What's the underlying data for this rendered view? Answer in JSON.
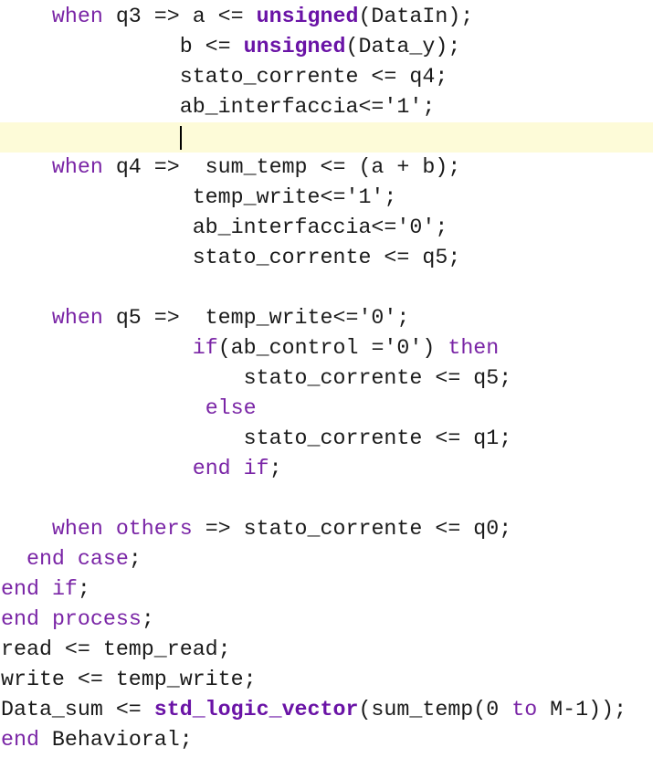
{
  "editor": {
    "language": "VHDL",
    "current_line_index": 4,
    "colors": {
      "keyword": "#7a25a6",
      "builtin_function": "#6a13a6",
      "text": "#1a1a1a",
      "current_line_highlight": "#fdfbd8"
    },
    "lines": [
      [
        {
          "t": "    "
        },
        {
          "t": "when",
          "k": "kw"
        },
        {
          "t": " q3 => a <= "
        },
        {
          "t": "unsigned",
          "k": "fn"
        },
        {
          "t": "(DataIn);"
        }
      ],
      [
        {
          "t": "              b <= "
        },
        {
          "t": "unsigned",
          "k": "fn"
        },
        {
          "t": "(Data_y);"
        }
      ],
      [
        {
          "t": "              stato_corrente <= q4;"
        }
      ],
      [
        {
          "t": "              ab_interfaccia<='1';"
        }
      ],
      [
        {
          "t": "              "
        }
      ],
      [
        {
          "t": "    "
        },
        {
          "t": "when",
          "k": "kw"
        },
        {
          "t": " q4 =>  sum_temp <= (a + b);"
        }
      ],
      [
        {
          "t": "               temp_write<='1';"
        }
      ],
      [
        {
          "t": "               ab_interfaccia<='0';"
        }
      ],
      [
        {
          "t": "               stato_corrente <= q5;"
        }
      ],
      [
        {
          "t": ""
        }
      ],
      [
        {
          "t": "    "
        },
        {
          "t": "when",
          "k": "kw"
        },
        {
          "t": " q5 =>  temp_write<='0';"
        }
      ],
      [
        {
          "t": "               "
        },
        {
          "t": "if",
          "k": "kw"
        },
        {
          "t": "(ab_control ='0') "
        },
        {
          "t": "then",
          "k": "kw"
        }
      ],
      [
        {
          "t": "                   stato_corrente <= q5;"
        }
      ],
      [
        {
          "t": "                "
        },
        {
          "t": "else",
          "k": "kw"
        }
      ],
      [
        {
          "t": "                   stato_corrente <= q1;"
        }
      ],
      [
        {
          "t": "               "
        },
        {
          "t": "end",
          "k": "kw"
        },
        {
          "t": " "
        },
        {
          "t": "if",
          "k": "kw"
        },
        {
          "t": ";"
        }
      ],
      [
        {
          "t": ""
        }
      ],
      [
        {
          "t": "    "
        },
        {
          "t": "when",
          "k": "kw"
        },
        {
          "t": " "
        },
        {
          "t": "others",
          "k": "kw"
        },
        {
          "t": " => stato_corrente <= q0;"
        }
      ],
      [
        {
          "t": "  "
        },
        {
          "t": "end",
          "k": "kw"
        },
        {
          "t": " "
        },
        {
          "t": "case",
          "k": "kw"
        },
        {
          "t": ";"
        }
      ],
      [
        {
          "t": "end",
          "k": "kw"
        },
        {
          "t": " "
        },
        {
          "t": "if",
          "k": "kw"
        },
        {
          "t": ";"
        }
      ],
      [
        {
          "t": "end",
          "k": "kw"
        },
        {
          "t": " "
        },
        {
          "t": "process",
          "k": "kw"
        },
        {
          "t": ";"
        }
      ],
      [
        {
          "t": "read <= temp_read;"
        }
      ],
      [
        {
          "t": "write <= temp_write;"
        }
      ],
      [
        {
          "t": "Data_sum <= "
        },
        {
          "t": "std_logic_vector",
          "k": "fn"
        },
        {
          "t": "(sum_temp(0 "
        },
        {
          "t": "to",
          "k": "kw"
        },
        {
          "t": " M-1));"
        }
      ],
      [
        {
          "t": "end",
          "k": "kw"
        },
        {
          "t": " Behavioral;"
        }
      ]
    ]
  }
}
